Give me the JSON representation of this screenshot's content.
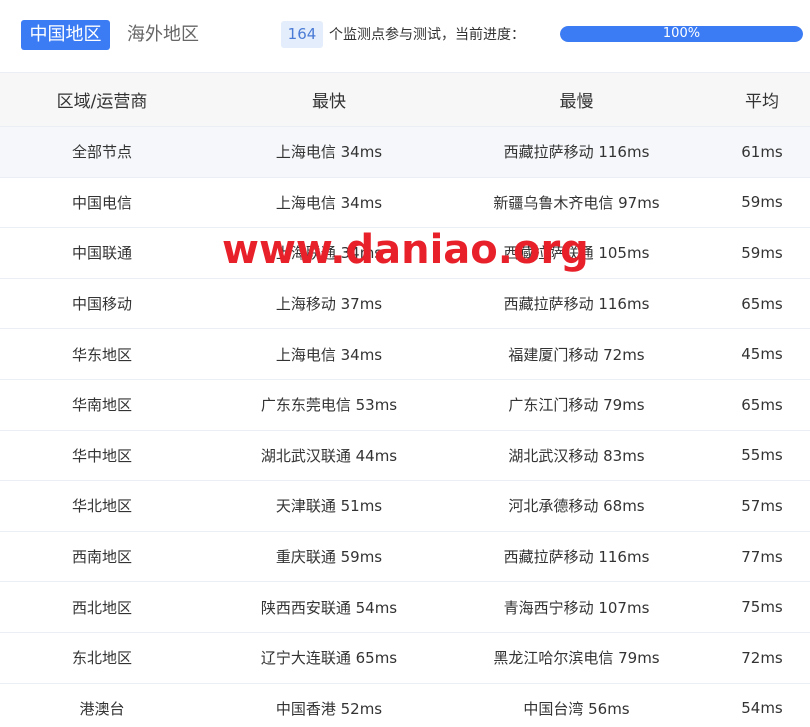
{
  "tabs": [
    {
      "label": "中国地区",
      "active": true
    },
    {
      "label": "海外地区",
      "active": false
    }
  ],
  "progress": {
    "count": "164",
    "text": "个监测点参与测试，当前进度：",
    "percent_label": "100%",
    "fraction": 1.0
  },
  "table": {
    "headers": [
      "区域/运营商",
      "最快",
      "最慢",
      "平均"
    ],
    "rows": [
      [
        "全部节点",
        "上海电信 34ms",
        "西藏拉萨移动 116ms",
        "61ms"
      ],
      [
        "中国电信",
        "上海电信 34ms",
        "新疆乌鲁木齐电信 97ms",
        "59ms"
      ],
      [
        "中国联通",
        "上海联通 34ms",
        "西藏拉萨联通 105ms",
        "59ms"
      ],
      [
        "中国移动",
        "上海移动 37ms",
        "西藏拉萨移动 116ms",
        "65ms"
      ],
      [
        "华东地区",
        "上海电信 34ms",
        "福建厦门移动 72ms",
        "45ms"
      ],
      [
        "华南地区",
        "广东东莞电信 53ms",
        "广东江门移动 79ms",
        "65ms"
      ],
      [
        "华中地区",
        "湖北武汉联通 44ms",
        "湖北武汉移动 83ms",
        "55ms"
      ],
      [
        "华北地区",
        "天津联通 51ms",
        "河北承德移动 68ms",
        "57ms"
      ],
      [
        "西南地区",
        "重庆联通 59ms",
        "西藏拉萨移动 116ms",
        "77ms"
      ],
      [
        "西北地区",
        "陕西西安联通 54ms",
        "青海西宁移动 107ms",
        "75ms"
      ],
      [
        "东北地区",
        "辽宁大连联通 65ms",
        "黑龙江哈尔滨电信 79ms",
        "72ms"
      ],
      [
        "港澳台",
        "中国香港 52ms",
        "中国台湾 56ms",
        "54ms"
      ]
    ]
  },
  "watermark": "www.daniao.org",
  "colors": {
    "accent": "#3b7cf4",
    "badge_bg": "#e4edfb",
    "badge_text": "#4a7bd6",
    "watermark": "#e8202a"
  }
}
